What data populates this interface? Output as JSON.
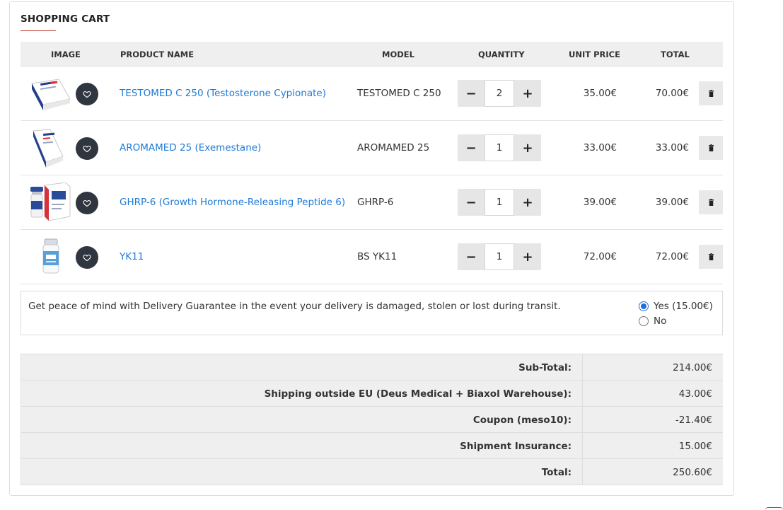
{
  "cart": {
    "title": "SHOPPING CART",
    "columns": {
      "image": "IMAGE",
      "product_name": "PRODUCT NAME",
      "model": "MODEL",
      "quantity": "QUANTITY",
      "unit_price": "UNIT PRICE",
      "total": "TOTAL"
    },
    "items": [
      {
        "name": "TESTOMED C 250 (Testosterone Cypionate)",
        "model": "TESTOMED C 250",
        "quantity": "2",
        "unit_price": "35.00€",
        "total": "70.00€",
        "image_icon": "testomed-box-image",
        "accent": "#1f3f8f"
      },
      {
        "name": "AROMAMED 25 (Exemestane)",
        "model": "AROMAMED 25",
        "quantity": "1",
        "unit_price": "33.00€",
        "total": "33.00€",
        "image_icon": "aromamed-box-image",
        "accent": "#1f3f8f"
      },
      {
        "name": "GHRP-6 (Growth Hormone-Releasing Peptide 6)",
        "model": "GHRP-6",
        "quantity": "1",
        "unit_price": "39.00€",
        "total": "39.00€",
        "image_icon": "ghrp6-vial-image",
        "accent": "#2a4a9a"
      },
      {
        "name": "YK11",
        "model": "BS YK11",
        "quantity": "1",
        "unit_price": "72.00€",
        "total": "72.00€",
        "image_icon": "yk11-bottle-image",
        "accent": "#5aa0d8"
      }
    ]
  },
  "guarantee": {
    "text": "Get peace of mind with Delivery Guarantee in the event your delivery is damaged, stolen or lost during transit.",
    "options": [
      {
        "label": "Yes (15.00€)",
        "checked": true
      },
      {
        "label": "No",
        "checked": false
      }
    ]
  },
  "totals": [
    {
      "label": "Sub-Total:",
      "value": "214.00€"
    },
    {
      "label": "Shipping outside EU (Deus Medical + Biaxol Warehouse):",
      "value": "43.00€"
    },
    {
      "label": "Coupon (meso10):",
      "value": "-21.40€"
    },
    {
      "label": "Shipment Insurance:",
      "value": "15.00€"
    },
    {
      "label": "Total:",
      "value": "250.60€"
    }
  ],
  "icons": {
    "wishlist": "heart-icon",
    "minus": "minus-icon",
    "plus": "plus-icon",
    "remove": "trash-icon"
  },
  "colors": {
    "link": "#1f7ad6",
    "accent": "#c0392b",
    "radio": "#1f6fe0",
    "dark_button": "#2f3640"
  }
}
